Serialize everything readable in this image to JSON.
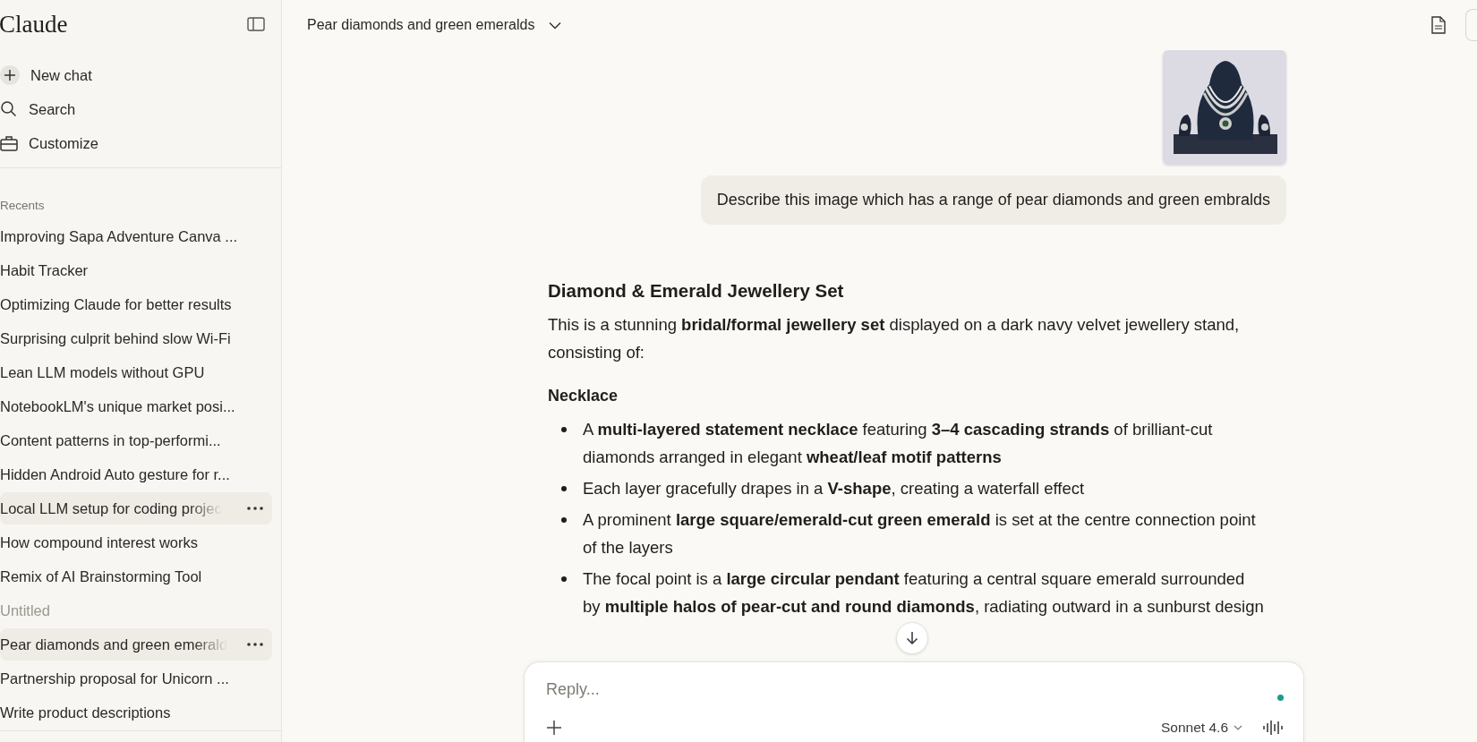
{
  "sidebar": {
    "logo": "Claude",
    "actions": [
      {
        "kind": "new",
        "label": "New chat"
      },
      {
        "kind": "search",
        "label": "Search"
      },
      {
        "kind": "customize",
        "label": "Customize"
      }
    ],
    "section_label": "Recents",
    "chats": [
      {
        "title": "Improving Sapa Adventure Canva ...",
        "highlighted": false,
        "dimmed": false
      },
      {
        "title": "Habit Tracker",
        "highlighted": false,
        "dimmed": false
      },
      {
        "title": "Optimizing Claude for better results",
        "highlighted": false,
        "dimmed": false
      },
      {
        "title": "Surprising culprit behind slow Wi-Fi",
        "highlighted": false,
        "dimmed": false
      },
      {
        "title": "Lean LLM models without GPU",
        "highlighted": false,
        "dimmed": false
      },
      {
        "title": "NotebookLM's unique market posi...",
        "highlighted": false,
        "dimmed": false
      },
      {
        "title": "Content patterns in top-performi...",
        "highlighted": false,
        "dimmed": false
      },
      {
        "title": "Hidden Android Auto gesture for r...",
        "highlighted": false,
        "dimmed": false
      },
      {
        "title": "Local LLM setup for coding projec",
        "highlighted": true,
        "dimmed": false
      },
      {
        "title": "How compound interest works",
        "highlighted": false,
        "dimmed": false
      },
      {
        "title": "Remix of AI Brainstorming Tool",
        "highlighted": false,
        "dimmed": false
      },
      {
        "title": "Untitled",
        "highlighted": false,
        "dimmed": true
      },
      {
        "title": "Pear diamonds and green emerald",
        "highlighted": true,
        "dimmed": false
      },
      {
        "title": "Partnership proposal for Unicorn ...",
        "highlighted": false,
        "dimmed": false
      },
      {
        "title": "Write product descriptions",
        "highlighted": false,
        "dimmed": false
      }
    ]
  },
  "header": {
    "title": "Pear diamonds and green emeralds"
  },
  "conversation": {
    "user_message": "Describe this image which has a range of pear diamonds and green embralds",
    "response": [
      {
        "kind": "heading",
        "text": "Diamond & Emerald Jewellery Set"
      },
      {
        "kind": "paragraph",
        "text": "This is a stunning **bridal/formal jewellery set** displayed on a dark navy velvet jewellery stand, consisting of:"
      },
      {
        "kind": "subheading",
        "text": "Necklace"
      },
      {
        "kind": "bullet",
        "text": "A **multi-layered statement necklace** featuring **3–4 cascading strands** of brilliant-cut diamonds arranged in elegant **wheat/leaf motif patterns**"
      },
      {
        "kind": "bullet",
        "text": "Each layer gracefully drapes in a **V-shape**, creating a waterfall effect"
      },
      {
        "kind": "bullet",
        "text": "A prominent **large square/emerald-cut green emerald** is set at the centre connection point of the layers"
      },
      {
        "kind": "bullet",
        "text": "The focal point is a **large circular pendant** featuring a central square emerald surrounded by **multiple halos of pear-cut and round diamonds**, radiating outward in a sunburst design"
      }
    ]
  },
  "composer": {
    "placeholder": "Reply...",
    "model": "Sonnet 4.6"
  }
}
